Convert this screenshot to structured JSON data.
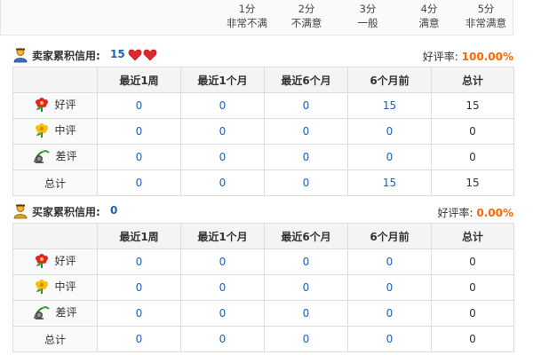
{
  "scale": [
    {
      "score": "1分",
      "label": "非常不满"
    },
    {
      "score": "2分",
      "label": "不满意"
    },
    {
      "score": "3分",
      "label": "一般"
    },
    {
      "score": "4分",
      "label": "满意"
    },
    {
      "score": "5分",
      "label": "非常满意"
    }
  ],
  "seller": {
    "title": "卖家累积信用:",
    "credit": "15",
    "rate_label": "好评率:",
    "rate_value": "100.00%",
    "columns": [
      "最近1周",
      "最近1个月",
      "最近6个月",
      "6个月前",
      "总计"
    ],
    "rows": [
      {
        "label": "好评",
        "icon": "red-flower-icon",
        "values": [
          "0",
          "0",
          "0",
          "15",
          "15"
        ]
      },
      {
        "label": "中评",
        "icon": "yellow-flower-icon",
        "values": [
          "0",
          "0",
          "0",
          "0",
          "0"
        ]
      },
      {
        "label": "差评",
        "icon": "bad-rating-icon",
        "values": [
          "0",
          "0",
          "0",
          "0",
          "0"
        ]
      },
      {
        "label": "总计",
        "icon": "",
        "values": [
          "0",
          "0",
          "0",
          "15",
          "15"
        ]
      }
    ]
  },
  "buyer": {
    "title": "买家累积信用:",
    "credit": "0",
    "rate_label": "好评率:",
    "rate_value": "0.00%",
    "columns": [
      "最近1周",
      "最近1个月",
      "最近6个月",
      "6个月前",
      "总计"
    ],
    "rows": [
      {
        "label": "好评",
        "icon": "red-flower-icon",
        "values": [
          "0",
          "0",
          "0",
          "0",
          "0"
        ]
      },
      {
        "label": "中评",
        "icon": "yellow-flower-icon",
        "values": [
          "0",
          "0",
          "0",
          "0",
          "0"
        ]
      },
      {
        "label": "差评",
        "icon": "bad-rating-icon",
        "values": [
          "0",
          "0",
          "0",
          "0",
          "0"
        ]
      },
      {
        "label": "总计",
        "icon": "",
        "values": [
          "0",
          "0",
          "0",
          "0",
          "0"
        ]
      }
    ]
  },
  "colors": {
    "link_blue": "#1f62b5",
    "accent_orange": "#ff6600",
    "heart_red": "#e2272d"
  }
}
